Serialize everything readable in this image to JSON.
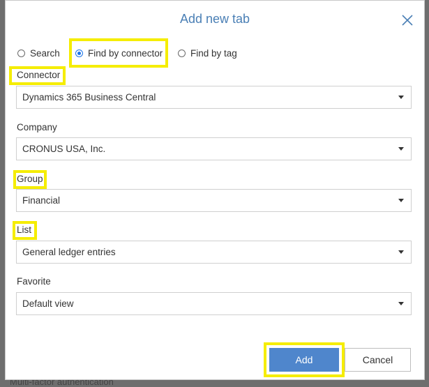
{
  "dialog": {
    "title": "Add new tab",
    "close_label": "×"
  },
  "backdrop": {
    "text": "Multi-factor authentication"
  },
  "mode_options": [
    {
      "label": "Search",
      "selected": false
    },
    {
      "label": "Find by connector",
      "selected": true
    },
    {
      "label": "Find by tag",
      "selected": false
    }
  ],
  "fields": {
    "connector": {
      "label": "Connector",
      "value": "Dynamics 365 Business Central"
    },
    "company": {
      "label": "Company",
      "value": "CRONUS USA, Inc."
    },
    "group": {
      "label": "Group",
      "value": "Financial"
    },
    "list": {
      "label": "List",
      "value": "General ledger entries"
    },
    "favorite": {
      "label": "Favorite",
      "value": "Default view"
    }
  },
  "buttons": {
    "add": "Add",
    "cancel": "Cancel"
  },
  "colors": {
    "title": "#4a7fb5",
    "primary_button": "#4f86cc",
    "highlight": "#f5ed00",
    "radio_selected": "#1a73e8"
  }
}
